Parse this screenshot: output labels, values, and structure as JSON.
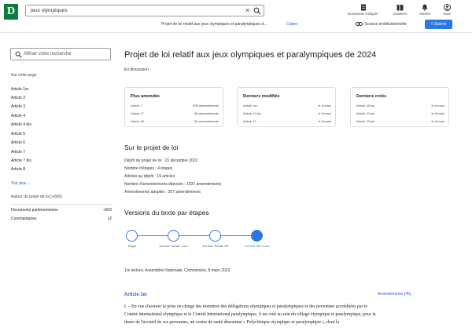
{
  "search": {
    "query": "jeux olympiques"
  },
  "nav": [
    {
      "label": "Document Analyzer",
      "icon": "document-icon"
    },
    {
      "label": "Dossiers",
      "icon": "folder-icon"
    },
    {
      "label": "Alertes",
      "icon": "bell-icon"
    },
    {
      "label": "Vous",
      "icon": "user-icon"
    }
  ],
  "subheader": {
    "title": "Projet de loi relatif aux jeux olympiques et paralympiques d...",
    "copy": "Copier",
    "source": "Source institutionnelle",
    "save": "Suivre"
  },
  "sidebar": {
    "filter_placeholder": "Affiner votre recherche",
    "section_label": "Sur cette page",
    "articles": [
      "Article 1er",
      "Article 2",
      "Article 3",
      "Article 4",
      "Article 4 bis",
      "Article 5",
      "Article 6",
      "Article 7",
      "Article 7 bis",
      "Article 8"
    ],
    "more": "Voir plus",
    "around_label": "Autour du projet de loi (+500)",
    "related": [
      {
        "label": "Documents parlementaires",
        "count": "+500"
      },
      {
        "label": "Commentaires",
        "count": "12"
      }
    ]
  },
  "main": {
    "title": "Projet de loi relatif aux jeux olympiques et paralympiques de 2024",
    "status": "En discussion",
    "cards": [
      {
        "title": "Plus amendés",
        "rows": [
          {
            "label": "Article 7",
            "value": "208 amendements"
          },
          {
            "label": "Article 17",
            "value": "85 amendements"
          },
          {
            "label": "Article 18",
            "value": "52 amendements"
          }
        ]
      },
      {
        "title": "Derniers modifiés",
        "rows": [
          {
            "label": "Article 1er",
            "value": "le 8 mars"
          },
          {
            "label": "Article 13 bis",
            "value": "le 8 mars"
          },
          {
            "label": "Article 17",
            "value": "le 8 mars"
          }
        ]
      },
      {
        "title": "Derniers créés",
        "rows": [
          {
            "label": "Article 18 bis",
            "value": "le 8 mars"
          },
          {
            "label": "Article 14 bis",
            "value": "le 8 mars"
          },
          {
            "label": "Article 13 bis",
            "value": "le 8 mars"
          }
        ]
      }
    ],
    "about_heading": "Sur le projet de loi",
    "about": [
      "Dépôt du projet de loi : 21 décembre 2022",
      "Nombre d'étapes : 4 étapes",
      "Articles au dépôt : 19 articles",
      "Nombre d'amendements déposés : 1037 amendements",
      "Amendements adoptés : 207 amendements"
    ],
    "versions_heading": "Versions du texte par étapes",
    "steps": [
      {
        "label": "Dépôt"
      },
      {
        "label": "1re lect. Sénat, Com."
      },
      {
        "label": "1re lect. Sénat, SP"
      },
      {
        "label": "1re lect. AN, Com."
      }
    ],
    "caption": "1re lecture, Assemblée Nationale, Commission, 8 mars 2023",
    "article_title": "Article 1er",
    "amendments_link": "Amendements (45)",
    "article_text": "I. – En vue d'assurer la prise en charge des membres des délégations olympiques et paralympiques et des personnes accréditées par le Comité international olympique et le Comité international paralympique, il est créé au sein du village olympique et paralympique, pour la durée de l'accueil de ces personnes, un centre de santé dénommé « Polyclinique olympique et paralympique », dont la"
  }
}
